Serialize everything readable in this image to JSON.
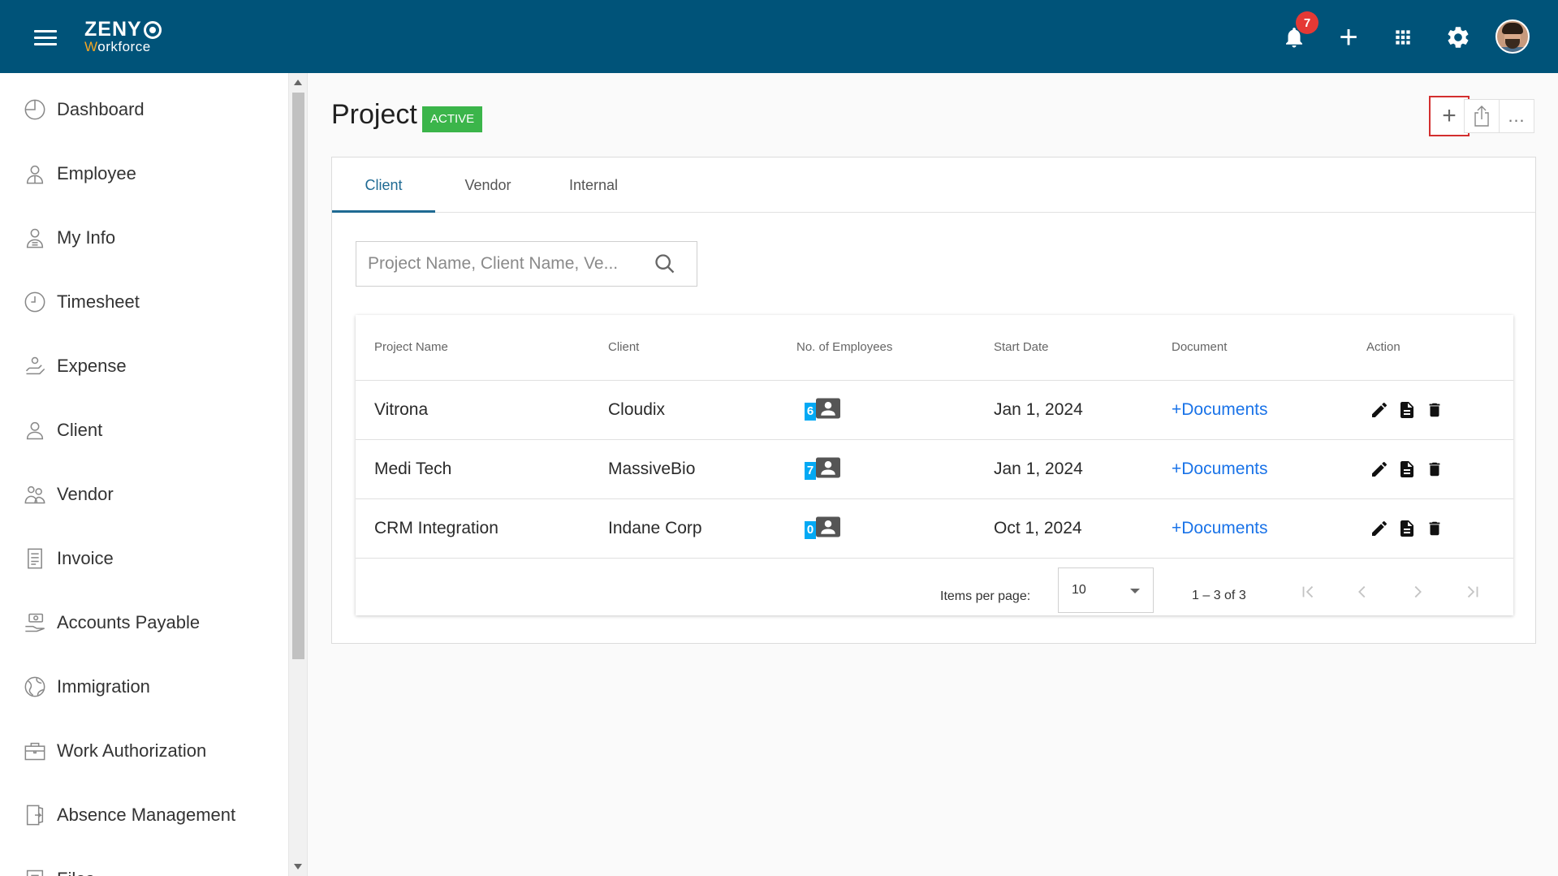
{
  "app": {
    "logo_line1": "ZENY",
    "logo_line2_first": "W",
    "logo_line2_rest": "orkforce",
    "notification_count": "7",
    "plus_label": "+"
  },
  "sidebar": {
    "items": [
      {
        "label": "Dashboard",
        "icon": "dashboard-icon"
      },
      {
        "label": "Employee",
        "icon": "employee-icon"
      },
      {
        "label": "My Info",
        "icon": "my-info-icon"
      },
      {
        "label": "Timesheet",
        "icon": "clock-icon"
      },
      {
        "label": "Expense",
        "icon": "expense-icon"
      },
      {
        "label": "Client",
        "icon": "person-icon"
      },
      {
        "label": "Vendor",
        "icon": "vendor-icon"
      },
      {
        "label": "Invoice",
        "icon": "invoice-icon"
      },
      {
        "label": "Accounts Payable",
        "icon": "accounts-payable-icon"
      },
      {
        "label": "Immigration",
        "icon": "globe-icon"
      },
      {
        "label": "Work Authorization",
        "icon": "briefcase-icon"
      },
      {
        "label": "Absence Management",
        "icon": "door-icon"
      },
      {
        "label": "Files",
        "icon": "files-icon"
      }
    ]
  },
  "page": {
    "title": "Project",
    "status": "ACTIVE",
    "more_label": "…",
    "add_label": "+"
  },
  "tabs": [
    {
      "label": "Client",
      "active": true
    },
    {
      "label": "Vendor",
      "active": false
    },
    {
      "label": "Internal",
      "active": false
    }
  ],
  "search": {
    "placeholder": "Project Name, Client Name, Ve..."
  },
  "table": {
    "columns": [
      "Project Name",
      "Client",
      "No. of Employees",
      "Start Date",
      "Document",
      "Action"
    ],
    "rows": [
      {
        "project": "Vitrona",
        "client": "Cloudix",
        "employees": "6",
        "start": "Jan 1, 2024",
        "document": "+Documents"
      },
      {
        "project": "Medi Tech",
        "client": "MassiveBio",
        "employees": "7",
        "start": "Jan 1, 2024",
        "document": "+Documents"
      },
      {
        "project": "CRM Integration",
        "client": "Indane Corp",
        "employees": "0",
        "start": "Oct 1, 2024",
        "document": "+Documents"
      }
    ]
  },
  "pager": {
    "label": "Items per page:",
    "page_size": "10",
    "range": "1 – 3 of 3"
  },
  "colors": {
    "topbar": "#005379",
    "accent": "#1f6a93",
    "status_green": "#3bb54a",
    "link": "#1a73e8",
    "badge_red": "#e53935",
    "employee_count": "#03a9f4"
  }
}
